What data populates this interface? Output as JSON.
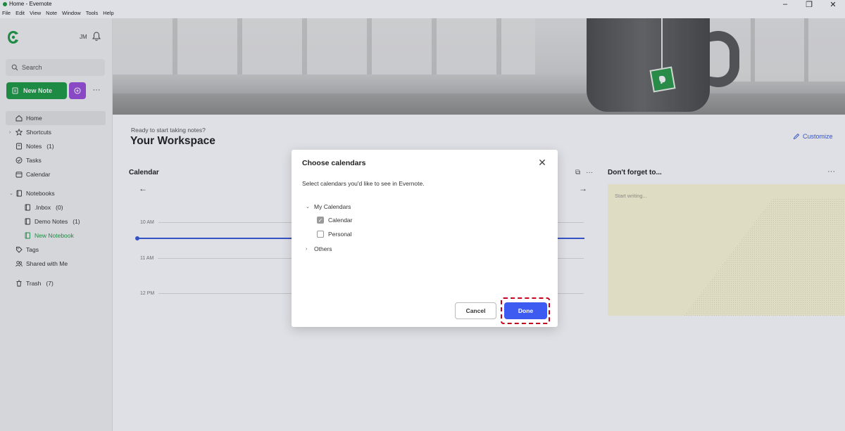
{
  "window": {
    "title": "Home - Evernote",
    "menu": [
      "File",
      "Edit",
      "View",
      "Note",
      "Window",
      "Tools",
      "Help"
    ],
    "controls": [
      "–",
      "❐",
      "✕"
    ]
  },
  "sidebar": {
    "account_initials": "JM",
    "search_label": "Search",
    "new_note_label": "New Note",
    "more_label": "···",
    "nav": {
      "home": "Home",
      "shortcuts": "Shortcuts",
      "notes": "Notes",
      "notes_count": "(1)",
      "tasks": "Tasks",
      "calendar": "Calendar",
      "notebooks": "Notebooks",
      "nb_inbox": ".Inbox",
      "nb_inbox_count": "(0)",
      "nb_demo": "Demo Notes",
      "nb_demo_count": "(1)",
      "nb_new": "New Notebook",
      "tags": "Tags",
      "shared": "Shared with Me",
      "trash": "Trash",
      "trash_count": "(7)"
    }
  },
  "main": {
    "subtitle": "Ready to start taking notes?",
    "title": "Your Workspace",
    "customize_label": "Customize",
    "calendar": {
      "title": "Calendar",
      "hours": [
        "10 AM",
        "11 AM",
        "12 PM"
      ]
    },
    "dont_forget": {
      "title": "Don't forget to...",
      "placeholder": "Start writing..."
    }
  },
  "dialog": {
    "title": "Choose calendars",
    "description": "Select calendars you'd like to see in Evernote.",
    "groups": {
      "my_calendars": "My Calendars",
      "others": "Others"
    },
    "calendars": [
      {
        "label": "Calendar",
        "checked": true
      },
      {
        "label": "Personal",
        "checked": false
      }
    ],
    "cancel_label": "Cancel",
    "done_label": "Done"
  },
  "colors": {
    "brand_green": "#1f9d45",
    "accent_blue": "#3d5af1",
    "ai_purple": "#9b4fd9",
    "highlight_red": "#c4001a"
  }
}
